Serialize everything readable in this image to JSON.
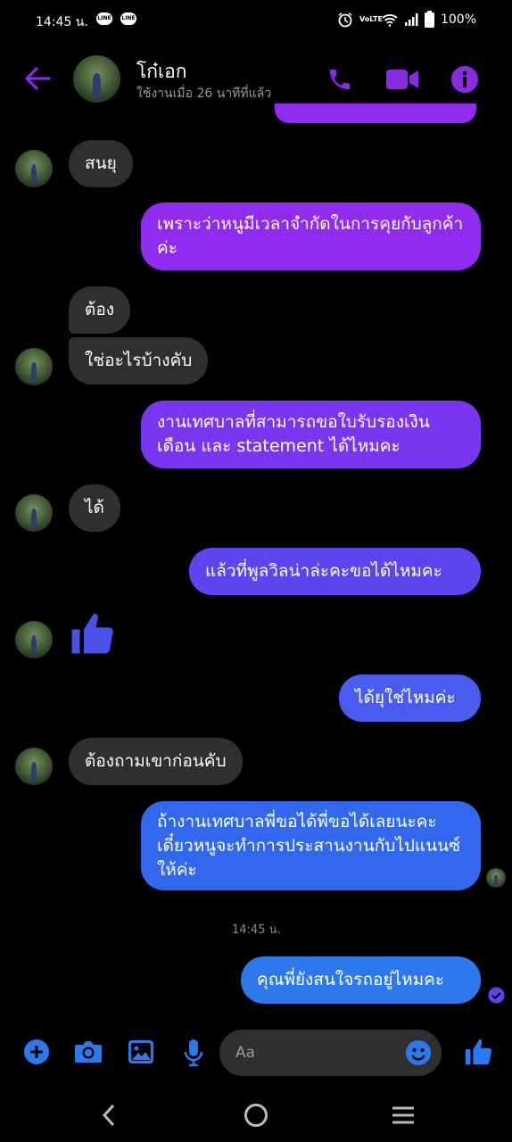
{
  "status": {
    "time": "14:45 น.",
    "app_badge_1": "LINE",
    "app_badge_2": "LINE",
    "network": "VoLTE",
    "battery": "100%"
  },
  "header": {
    "name": "โก๋เอก",
    "last_active": "ใช้งานเมื่อ 26 นาทีที่แล้ว"
  },
  "messages": [
    {
      "from": "them",
      "text": "สนยุ"
    },
    {
      "from": "me",
      "text": "เพราะว่าหนูมีเวลาจำกัดในการคุยกับลูกค้าค่ะ"
    },
    {
      "from": "them",
      "text": "ต้อง"
    },
    {
      "from": "them",
      "text": "ใช่อะไรบ้างคับ"
    },
    {
      "from": "me",
      "text": "งานเทศบาลที่สามารถขอใบรับรองเงินเดือน และ statement ได้ไหมคะ"
    },
    {
      "from": "them",
      "text": "ได้"
    },
    {
      "from": "me",
      "text": "แล้วที่พูลวิลน่าล่ะคะขอได้ไหมคะ"
    },
    {
      "from": "me",
      "text": "ได้ยุใช่ไหมค่ะ"
    },
    {
      "from": "them",
      "text": "ต้องถามเขาก่อนคับ"
    },
    {
      "from": "me",
      "text": "ถ้างานเทศบาลพี่ขอได้พี่ขอได้เลยนะคะเดี๋ยวหนูจะทำการประสานงานกับไปแนนซ์ให้ค่ะ"
    },
    {
      "from": "me",
      "text": "คุณพี่ยังสนใจรถอยู่ไหมคะ"
    }
  ],
  "timestamp": "14:45 น.",
  "composer": {
    "placeholder": "Aa"
  },
  "colors": {
    "accent": "#8a2be2",
    "bubble_purple": "#8f2cf0",
    "bubble_indigo": "#5a45ef",
    "bubble_blue": "#2e78ee"
  }
}
